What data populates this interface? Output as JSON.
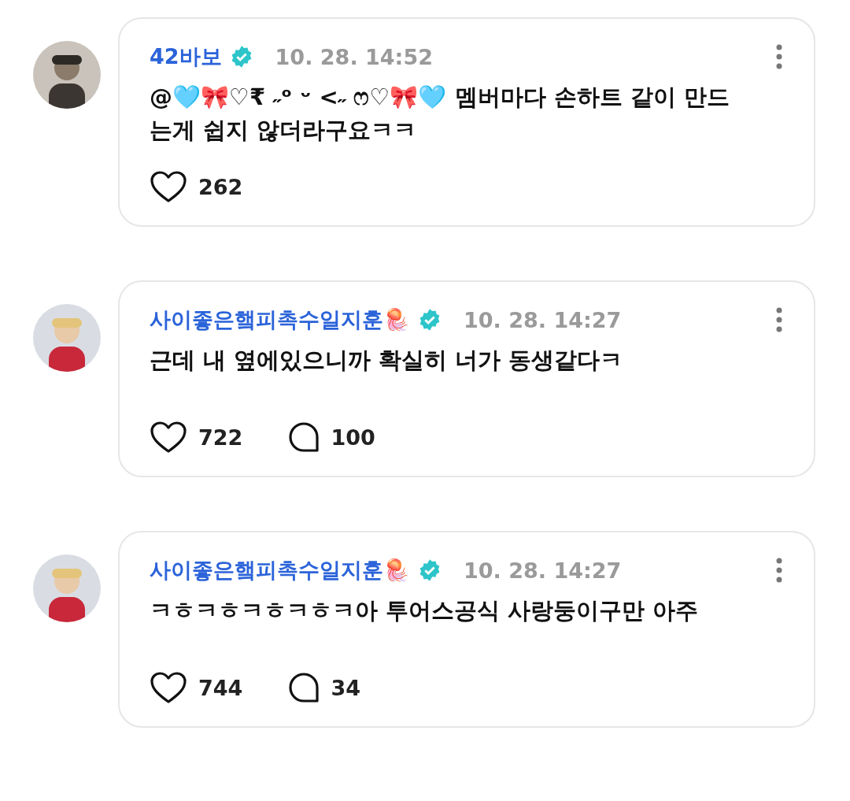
{
  "comments": [
    {
      "author": "42바보",
      "verified": true,
      "time": "10. 28. 14:52",
      "text": "@🩵🎀♡₹ ˶ᵒ ᵕ <˶ ෆ♡🎀🩵 멤버마다 손하트 같이 만드는게 쉽지 않더라구요ㅋㅋ",
      "likes": "262"
    },
    {
      "author": "사이좋은햌피촉수일지훈🪼",
      "verified": true,
      "time": "10. 28. 14:27",
      "text": "근데 내 옆에있으니까 확실히 너가 동생같다ㅋ",
      "likes": "722",
      "replies": "100"
    },
    {
      "author": "사이좋은햌피촉수일지훈🪼",
      "verified": true,
      "time": "10. 28. 14:27",
      "text": "ㅋㅎㅋㅎㅋㅎㅋㅎㅋ아 투어스공식 사랑둥이구만 아주",
      "likes": "744",
      "replies": "34"
    }
  ]
}
